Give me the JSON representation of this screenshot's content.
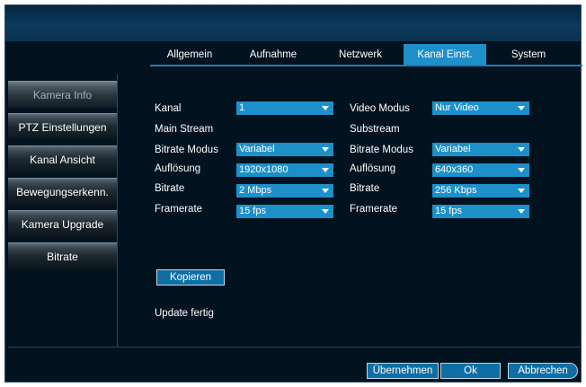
{
  "tabs": [
    "Allgemein",
    "Aufnahme",
    "Netzwerk",
    "Kanal Einst.",
    "System"
  ],
  "active_tab": "Kanal Einst.",
  "sidebar": [
    "Kamera Info",
    "PTZ Einstellungen",
    "Kanal Ansicht",
    "Bewegungserkenn.",
    "Kamera Upgrade",
    "Bitrate"
  ],
  "active_sidebar": "Kamera Info",
  "form": {
    "kanal_label": "Kanal",
    "kanal_value": "1",
    "video_modus_label": "Video Modus",
    "video_modus_value": "Nur Video",
    "main_stream_label": "Main Stream",
    "substream_label": "Substream",
    "main": {
      "bitrate_modus_label": "Bitrate Modus",
      "bitrate_modus_value": "Variabel",
      "aufloesung_label": "Auflösung",
      "aufloesung_value": "1920x1080",
      "bitrate_label": "Bitrate",
      "bitrate_value": "2 Mbps",
      "framerate_label": "Framerate",
      "framerate_value": "15 fps"
    },
    "sub": {
      "bitrate_modus_label": "Bitrate Modus",
      "bitrate_modus_value": "Variabel",
      "aufloesung_label": "Auflösung",
      "aufloesung_value": "640x360",
      "bitrate_label": "Bitrate",
      "bitrate_value": "256 Kbps",
      "framerate_label": "Framerate",
      "framerate_value": "15 fps"
    }
  },
  "copy_button": "Kopieren",
  "status_text": "Update fertig",
  "footer": {
    "apply": "Übernehmen",
    "ok": "Ok",
    "cancel": "Abbrechen"
  },
  "colors": {
    "background": "#02121f",
    "accent": "#1d90c9",
    "topband": "#0b3a5c"
  }
}
